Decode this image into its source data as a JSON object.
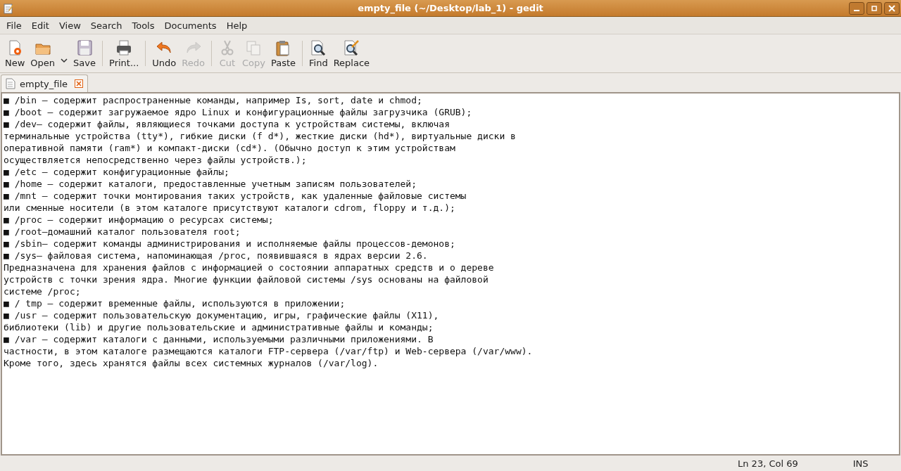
{
  "window": {
    "title": "empty_file (~/Desktop/lab_1) - gedit"
  },
  "menu": [
    "File",
    "Edit",
    "View",
    "Search",
    "Tools",
    "Documents",
    "Help"
  ],
  "toolbar": [
    {
      "kind": "button",
      "label": "New",
      "disabled": false
    },
    {
      "kind": "button",
      "label": "Open",
      "disabled": false
    },
    {
      "kind": "dropdown"
    },
    {
      "kind": "button",
      "label": "Save",
      "disabled": false
    },
    {
      "kind": "separator"
    },
    {
      "kind": "button",
      "label": "Print...",
      "disabled": false
    },
    {
      "kind": "separator"
    },
    {
      "kind": "button",
      "label": "Undo",
      "disabled": false
    },
    {
      "kind": "button",
      "label": "Redo",
      "disabled": true
    },
    {
      "kind": "separator"
    },
    {
      "kind": "button",
      "label": "Cut",
      "disabled": true
    },
    {
      "kind": "button",
      "label": "Copy",
      "disabled": true
    },
    {
      "kind": "button",
      "label": "Paste",
      "disabled": false
    },
    {
      "kind": "separator"
    },
    {
      "kind": "button",
      "label": "Find",
      "disabled": false
    },
    {
      "kind": "button",
      "label": "Replace",
      "disabled": false
    }
  ],
  "tabs": [
    {
      "label": "empty_file",
      "selected": true
    }
  ],
  "editor": {
    "lines": [
      "■ /bin — содержит распространенные команды, например Is, sort, date и chmod;",
      "■ /boot — содержит загружаемое ядро Linux и конфигурационные файлы загрузчика (GRUB);",
      "■ /dev— содержит файлы, являющиеся точками доступа к устройствам системы, включая",
      "терминальные устройства (tty*), гибкие диски (f d*), жесткие диски (hd*), виртуальные диски в",
      "оперативной памяти (ram*) и компакт-диски (cd*). (Обычно доступ к этим устройствам",
      "осуществляется непосредственно через файлы устройств.);",
      "■ /etc — содержит конфигурационные файлы;",
      "■ /home — содержит каталоги, предоставленные учетным записям пользователей;",
      "■ /mnt — содержит точки монтирования таких устройств, как удаленные файловые системы",
      "или сменные носители (в этом каталоге присутствуют каталоги cdrom, floppy и т.д.);",
      "■ /proc — содержит информацию о ресурсах системы;",
      "■ /root—домашний каталог пользователя root;",
      "■ /sbin— содержит команды администрирования и исполняемые файлы процессов-демонов;",
      "■ /sys— файловая система, напоминающая /proc, появившаяся в ядрах версии 2.6.",
      "Предназначена для хранения файлов с информацией о состоянии аппаратных средств и о дереве",
      "устройств с точки зрения ядра. Многие функции файловой системы /sys основаны на файловой",
      "системе /proc;",
      "■ / tmp — содержит временные файлы, используются в приложении;",
      "■ /usr — содержит пользовательскую документацию, игры, графические файлы (X11),",
      "библиотеки (lib) и другие пользовательские и административные файлы и команды;",
      "■ /var — содержит каталоги с данными, используемыми различными приложениями. В",
      "частности, в этом каталоге размещаются каталоги FTP-сервера (/var/ftp) и Web-сервера (/var/www).",
      "Кроме того, здесь хранятся файлы всех системных журналов (/var/log)."
    ]
  },
  "status_bar": {
    "position": "Ln 23, Col 69",
    "mode": "INS"
  }
}
